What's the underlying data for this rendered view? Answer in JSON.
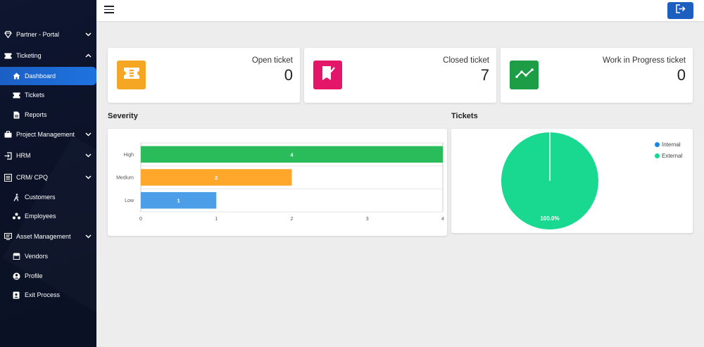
{
  "sidebar": {
    "items": [
      {
        "label": "Partner - Portal",
        "icon": "diamond-icon",
        "chevron": "down"
      },
      {
        "label": "Ticketing",
        "icon": "ticket-icon",
        "chevron": "up"
      },
      {
        "label": "Dashboard",
        "icon": "home-icon",
        "active": true
      },
      {
        "label": "Tickets",
        "icon": "ticket-icon"
      },
      {
        "label": "Reports",
        "icon": "report-icon"
      },
      {
        "label": "Project Management",
        "icon": "briefcase-icon",
        "chevron": "down"
      },
      {
        "label": "HRM",
        "icon": "login-icon",
        "chevron": "down"
      },
      {
        "label": "CRM/ CPQ",
        "icon": "list-icon",
        "chevron": "down"
      },
      {
        "label": "Customers",
        "icon": "person-walk-icon"
      },
      {
        "label": "Employees",
        "icon": "group-icon"
      },
      {
        "label": "Asset Management",
        "icon": "monitor-icon",
        "chevron": "down"
      },
      {
        "label": "Vendors",
        "icon": "store-icon"
      },
      {
        "label": "Profile",
        "icon": "account-circle-icon"
      },
      {
        "label": "Exit Process",
        "icon": "badge-icon"
      }
    ]
  },
  "cards": [
    {
      "title": "Open ticket",
      "value": "0",
      "color": "#f5a623",
      "icon": "ticket-icon"
    },
    {
      "title": "Closed ticket",
      "value": "7",
      "color": "#e4166a",
      "icon": "bookmark-check-icon"
    },
    {
      "title": "Work in Progress ticket",
      "value": "0",
      "color": "#1d9d46",
      "icon": "trending-icon"
    }
  ],
  "severity": {
    "title": "Severity",
    "chart_data": {
      "type": "bar",
      "orientation": "horizontal",
      "categories": [
        "High",
        "Medium",
        "Low"
      ],
      "values": [
        4,
        2,
        1
      ],
      "colors": [
        "#2abb5a",
        "#ffa72b",
        "#4c9ee8"
      ],
      "xlim": [
        0,
        4
      ],
      "xticks": [
        "0",
        "1",
        "2",
        "3",
        "4"
      ]
    }
  },
  "tickets": {
    "title": "Tickets",
    "chart_data": {
      "type": "pie",
      "labels": [
        "Internal",
        "External"
      ],
      "values": [
        0,
        100
      ],
      "colors": [
        "#1a86e0",
        "#19d990"
      ],
      "data_label": "100.0%",
      "legend": "top-right"
    }
  }
}
